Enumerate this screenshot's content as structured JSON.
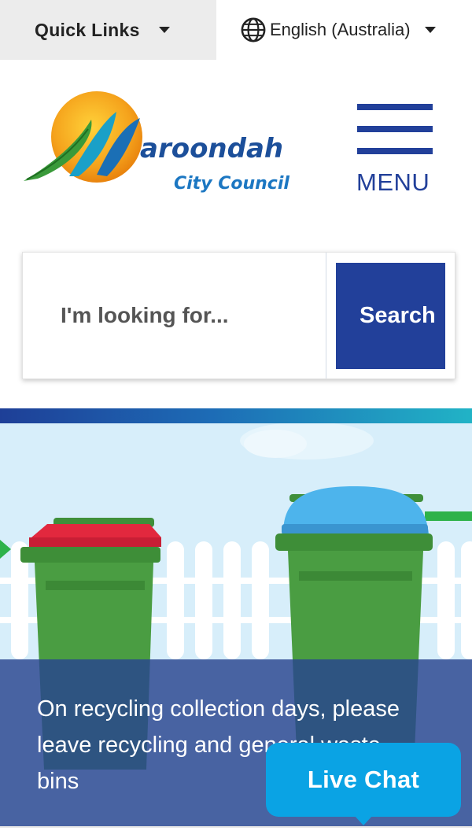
{
  "topbar": {
    "quick_links_label": "Quick Links",
    "language_label": "English (Australia)"
  },
  "logo": {
    "name_text": "aroondah",
    "sub_text": "City Council",
    "alt": "Maroondah City Council"
  },
  "menu": {
    "label": "MENU"
  },
  "search": {
    "placeholder": "I'm looking for...",
    "button_label": "Search"
  },
  "hero": {
    "message": "On recycling collection days, please leave recycling and general waste bins"
  },
  "live_chat": {
    "label": "Live Chat"
  },
  "colors": {
    "brand_blue": "#22409a",
    "chat_blue": "#0aa3e4",
    "sky": "#d7eefa"
  }
}
